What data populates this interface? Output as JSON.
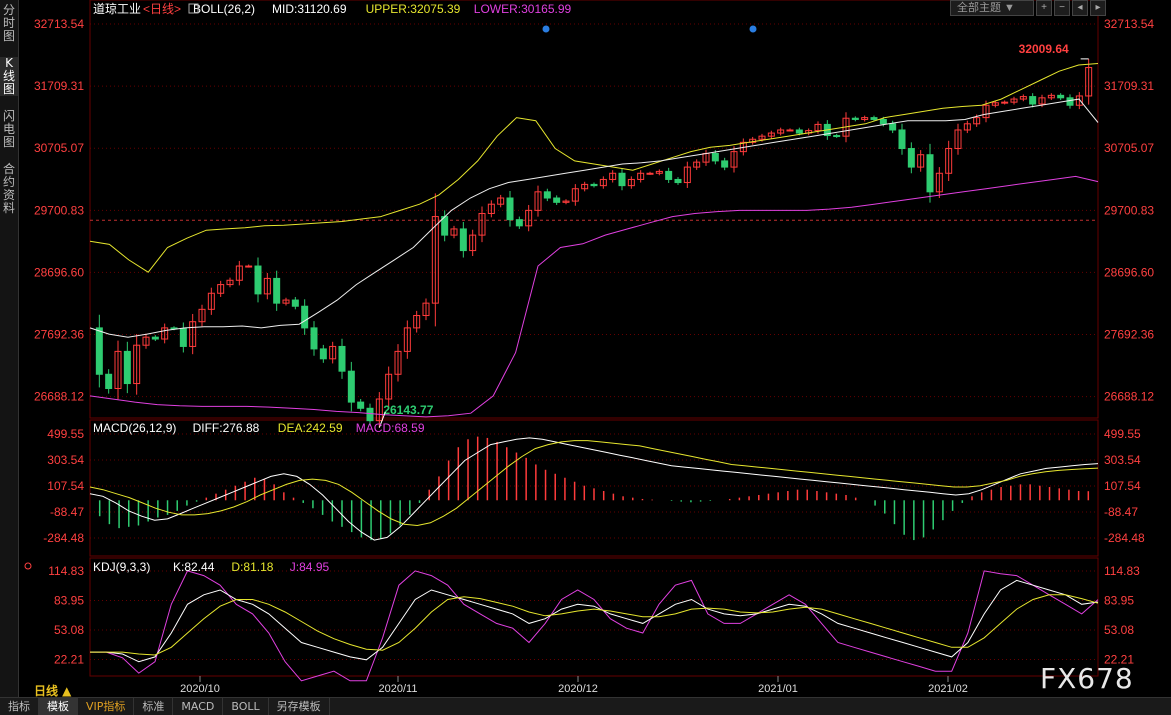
{
  "left_tabs": [
    {
      "label": "分时图"
    },
    {
      "label": "K线图"
    },
    {
      "label": "闪电图"
    },
    {
      "label": "合约资料"
    }
  ],
  "top_controls": {
    "theme": "全部主题 ▼",
    "icons": [
      "plus-square-icon",
      "minus-square-icon",
      "prev-square-icon",
      "next-square-icon"
    ]
  },
  "bottom_tabs": [
    {
      "label": "指标"
    },
    {
      "label": "模板"
    },
    {
      "label": "VIP指标"
    },
    {
      "label": "标准"
    },
    {
      "label": "MACD"
    },
    {
      "label": "BOLL"
    },
    {
      "label": "另存模板"
    }
  ],
  "period_label": "日线 ▲",
  "watermark": "FX678",
  "colors": {
    "up": "#ff3b3b",
    "down": "#2ecc71",
    "upper": "#e6e62e",
    "mid": "#eeeeee",
    "lower": "#e040e0",
    "axis": "#ff4040",
    "grid": "#660000"
  },
  "chart_data": [
    {
      "type": "candlestick",
      "legend": {
        "name": "道琼工业",
        "period": "<日线>",
        "indicator": "BOLL(26,2)",
        "mid": "MID:31120.69",
        "upper": "UPPER:32075.39",
        "lower": "LOWER:30165.99"
      },
      "y_ticks": [
        "32713.54",
        "31709.31",
        "30705.07",
        "29700.83",
        "28696.60",
        "27692.36",
        "26688.12"
      ],
      "x_labels": [
        "2020/10",
        "2020/11",
        "2020/12",
        "2021/01",
        "2021/02"
      ],
      "high_label": "32009.64",
      "low_label": "26143.77",
      "ref_line": 29540,
      "ylim": [
        26343,
        32713.54
      ],
      "start_close": 27800,
      "closes": [
        27050,
        26820,
        27420,
        26900,
        27520,
        27650,
        27620,
        27800,
        27790,
        27500,
        27900,
        28100,
        28360,
        28500,
        28570,
        28800,
        28800,
        28350,
        28600,
        28200,
        28250,
        28150,
        27800,
        27460,
        27300,
        27500,
        27100,
        26600,
        26500,
        26300,
        26650,
        27050,
        27420,
        27800,
        28000,
        28200,
        29600,
        29300,
        29400,
        29050,
        29300,
        29650,
        29800,
        29900,
        29550,
        29450,
        29700,
        30000,
        29900,
        29830,
        29850,
        30050,
        30120,
        30100,
        30200,
        30300,
        30100,
        30200,
        30300,
        30300,
        30330,
        30200,
        30150,
        30400,
        30480,
        30620,
        30500,
        30400,
        30650,
        30800,
        30850,
        30900,
        30950,
        31000,
        31000,
        30950,
        30990,
        31090,
        30910,
        30900,
        31190,
        31170,
        31200,
        31170,
        31100,
        31000,
        30700,
        30400,
        30600,
        30000,
        30300,
        30700,
        31000,
        31100,
        31200,
        31400,
        31440,
        31450,
        31500,
        31540,
        31420,
        31520,
        31560,
        31520,
        31400,
        31550,
        32009.64
      ],
      "upper": [
        29200,
        29150,
        28900,
        28700,
        29100,
        29250,
        29380,
        29400,
        29420,
        29450,
        29460,
        29480,
        29500,
        29520,
        29560,
        29600,
        29700,
        29800,
        29950,
        30200,
        30500,
        30900,
        31200,
        31150,
        30700,
        30500,
        30450,
        30400,
        30350,
        30450,
        30550,
        30650,
        30720,
        30750,
        30800,
        30850,
        30900,
        30950,
        31000,
        31050,
        31100,
        31200,
        31250,
        31300,
        31350,
        31380,
        31400,
        31500,
        31650,
        31800,
        31950,
        32050,
        32075.39
      ],
      "mid": [
        27800,
        27700,
        27650,
        27700,
        27760,
        27800,
        27820,
        27820,
        27830,
        27800,
        27840,
        27860,
        28050,
        28250,
        28500,
        28700,
        28900,
        29100,
        29400,
        29700,
        29900,
        30050,
        30150,
        30200,
        30250,
        30300,
        30350,
        30400,
        30450,
        30470,
        30500,
        30550,
        30600,
        30650,
        30700,
        30750,
        30800,
        30850,
        30900,
        30950,
        31000,
        31050,
        31100,
        31150,
        31150,
        31150,
        31170,
        31250,
        31300,
        31350,
        31400,
        31450,
        31500,
        31120.69
      ],
      "lower": [
        26700,
        26650,
        26600,
        26560,
        26540,
        26530,
        26530,
        26530,
        26520,
        26500,
        26480,
        26450,
        26430,
        26400,
        26380,
        26360,
        26380,
        26420,
        26700,
        27400,
        28800,
        29100,
        29160,
        29300,
        29400,
        29500,
        29600,
        29650,
        29680,
        29700,
        29700,
        29700,
        29700,
        29720,
        29750,
        29800,
        29850,
        29900,
        29950,
        30000,
        30050,
        30100,
        30150,
        30200,
        30250,
        30165.99
      ]
    },
    {
      "type": "bar",
      "legend": {
        "name": "MACD(26,12,9)",
        "diff": "DIFF:276.88",
        "dea": "DEA:242.59",
        "macd": "MACD:68.59"
      },
      "y_ticks": [
        "499.55",
        "303.54",
        "107.54",
        "-88.47",
        "-284.48"
      ],
      "ylim": [
        -420,
        560
      ],
      "hist": [
        -120,
        -180,
        -210,
        -200,
        -190,
        -160,
        -130,
        -110,
        -80,
        -40,
        -10,
        20,
        50,
        80,
        110,
        140,
        170,
        160,
        120,
        60,
        20,
        -20,
        -60,
        -110,
        -160,
        -200,
        -240,
        -280,
        -300,
        -290,
        -250,
        -190,
        -110,
        -20,
        80,
        180,
        300,
        400,
        460,
        480,
        470,
        440,
        400,
        360,
        320,
        270,
        230,
        200,
        170,
        140,
        110,
        90,
        70,
        50,
        30,
        20,
        10,
        5,
        0,
        -5,
        -10,
        -15,
        -10,
        -5,
        0,
        10,
        20,
        30,
        40,
        50,
        60,
        70,
        80,
        80,
        70,
        60,
        50,
        40,
        20,
        0,
        -40,
        -100,
        -180,
        -260,
        -300,
        -280,
        -220,
        -150,
        -80,
        -20,
        30,
        60,
        80,
        100,
        110,
        120,
        120,
        110,
        100,
        90,
        80,
        70,
        68.59
      ],
      "diff": [
        50,
        30,
        -20,
        -80,
        -120,
        -150,
        -140,
        -100,
        -60,
        -20,
        20,
        60,
        100,
        140,
        180,
        200,
        180,
        120,
        40,
        -60,
        -160,
        -240,
        -300,
        -280,
        -200,
        -100,
        0,
        100,
        200,
        300,
        360,
        420,
        440,
        460,
        470,
        460,
        440,
        420,
        400,
        380,
        360,
        340,
        320,
        300,
        280,
        260,
        250,
        240,
        230,
        220,
        210,
        200,
        190,
        180,
        170,
        160,
        150,
        140,
        130,
        120,
        110,
        100,
        90,
        80,
        70,
        60,
        50,
        40,
        50,
        80,
        120,
        160,
        200,
        220,
        240,
        250,
        260,
        270,
        276.88
      ],
      "dea": [
        100,
        80,
        50,
        20,
        -20,
        -60,
        -90,
        -110,
        -110,
        -100,
        -80,
        -50,
        -10,
        40,
        80,
        120,
        150,
        160,
        150,
        120,
        60,
        -10,
        -80,
        -140,
        -180,
        -190,
        -170,
        -120,
        -60,
        20,
        100,
        180,
        260,
        330,
        390,
        420,
        440,
        450,
        450,
        440,
        430,
        420,
        410,
        390,
        370,
        350,
        330,
        310,
        290,
        270,
        260,
        250,
        240,
        230,
        220,
        210,
        200,
        190,
        180,
        170,
        160,
        150,
        140,
        130,
        120,
        110,
        100,
        100,
        110,
        130,
        150,
        180,
        200,
        215,
        225,
        232,
        238,
        242.59
      ]
    },
    {
      "type": "line",
      "legend": {
        "name": "KDJ(9,3,3)",
        "k": "K:82.44",
        "d": "D:81.18",
        "j": "J:84.95"
      },
      "y_ticks": [
        "114.83",
        "83.95",
        "53.08",
        "22.21"
      ],
      "ylim": [
        5,
        118
      ],
      "k": [
        30,
        30,
        28,
        20,
        25,
        50,
        80,
        90,
        95,
        85,
        80,
        70,
        55,
        40,
        35,
        30,
        25,
        22,
        35,
        60,
        85,
        95,
        90,
        85,
        80,
        75,
        70,
        60,
        65,
        75,
        80,
        78,
        70,
        65,
        60,
        70,
        80,
        85,
        75,
        70,
        68,
        70,
        75,
        80,
        78,
        70,
        60,
        55,
        50,
        45,
        40,
        35,
        30,
        25,
        40,
        70,
        95,
        105,
        100,
        95,
        90,
        80,
        82.44
      ],
      "d": [
        30,
        30,
        30,
        28,
        27,
        35,
        50,
        65,
        78,
        85,
        85,
        80,
        72,
        62,
        52,
        44,
        38,
        33,
        32,
        40,
        55,
        72,
        85,
        88,
        86,
        82,
        78,
        72,
        68,
        70,
        73,
        75,
        73,
        70,
        67,
        67,
        70,
        75,
        76,
        75,
        72,
        71,
        72,
        75,
        77,
        75,
        70,
        65,
        60,
        55,
        50,
        45,
        40,
        35,
        35,
        45,
        60,
        75,
        85,
        90,
        90,
        86,
        81.18
      ],
      "j": [
        30,
        30,
        24,
        8,
        20,
        80,
        115,
        110,
        100,
        80,
        70,
        50,
        20,
        0,
        5,
        10,
        0,
        0,
        45,
        100,
        115,
        110,
        100,
        80,
        70,
        60,
        55,
        40,
        60,
        85,
        95,
        85,
        65,
        55,
        50,
        80,
        100,
        105,
        70,
        60,
        60,
        70,
        80,
        90,
        80,
        60,
        40,
        35,
        30,
        25,
        20,
        15,
        10,
        10,
        50,
        115,
        112,
        110,
        100,
        90,
        80,
        70,
        84.95
      ]
    }
  ]
}
